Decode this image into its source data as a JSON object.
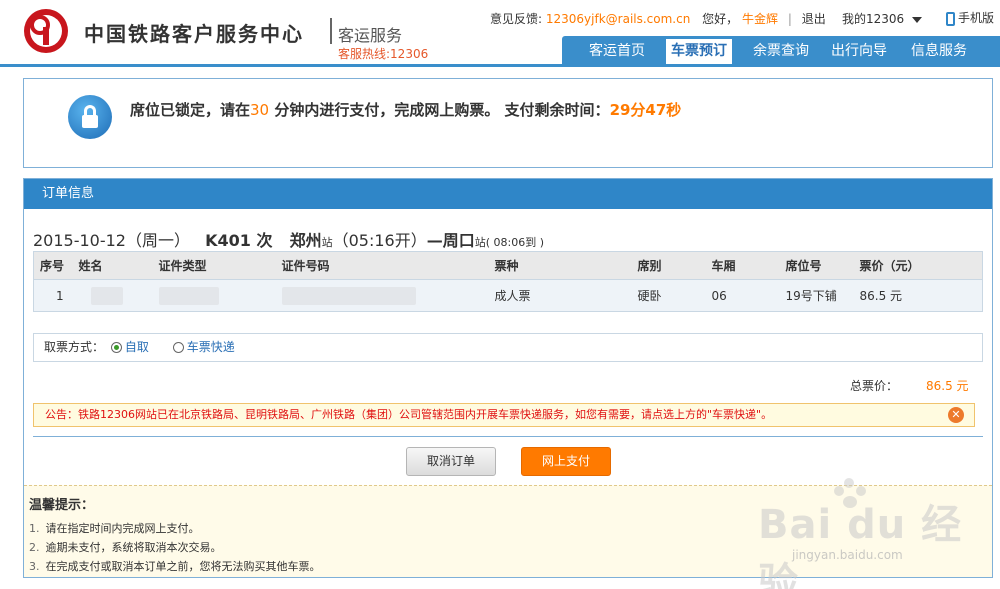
{
  "header": {
    "site_title": "中国铁路客户服务中心",
    "sub_title": "客运服务",
    "hotline": "客服热线:12306",
    "feedback_label": "意见反馈:",
    "feedback_email": "12306yjfk@rails.com.cn",
    "greeting": "您好，",
    "user_name": "牛金辉",
    "logout": "退出",
    "my12306": "我的12306",
    "mobile": "手机版"
  },
  "nav": {
    "items": [
      {
        "label": "客运首页",
        "active": false
      },
      {
        "label": "车票预订",
        "active": true
      },
      {
        "label": "余票查询",
        "active": false
      },
      {
        "label": "出行向导",
        "active": false
      },
      {
        "label": "信息服务",
        "active": false
      }
    ]
  },
  "notice": {
    "part1": "席位已锁定，请在",
    "minutes": "30",
    "part2": " 分钟内进行支付，完成网上购票。 支付剩余时间：",
    "remaining": "29分47秒"
  },
  "order": {
    "title": "订单信息",
    "train": {
      "date": "2015-10-12（周一）",
      "number": "K401 次",
      "from": "郑州",
      "from_suffix": "站",
      "depart": "（05:16开）",
      "to": "—周口",
      "to_suffix": "站",
      "arrive": "( 08:06到 )"
    },
    "columns": [
      "序号",
      "姓名",
      "证件类型",
      "证件号码",
      "票种",
      "席别",
      "车厢",
      "席位号",
      "票价（元）"
    ],
    "rows": [
      {
        "seq": "1",
        "ticket_type": "成人票",
        "seat_class": "硬卧",
        "car": "06",
        "seat_no": "19号下铺",
        "price": "86.5 元"
      }
    ],
    "pickup_label": "取票方式：",
    "pickup_self": "自取",
    "pickup_express": "车票快递",
    "total_label": "总票价：",
    "total_value": "86.5 元",
    "announcement": "公告：铁路12306网站已在北京铁路局、昆明铁路局、广州铁路（集团）公司管辖范围内开展车票快递服务，如您有需要，请点选上方的\"车票快递\"。",
    "cancel_button": "取消订单",
    "pay_button": "网上支付"
  },
  "tips": {
    "title": "温馨提示：",
    "items": [
      {
        "idx": "1.",
        "text": "请在指定时间内完成网上支付。"
      },
      {
        "idx": "2.",
        "text": "逾期未支付，系统将取消本次交易。"
      },
      {
        "idx": "3.",
        "text": "在完成支付或取消本订单之前，您将无法购买其他车票。"
      }
    ]
  },
  "watermark": {
    "brand": "Bai du 经验",
    "url": "jingyan.baidu.com"
  }
}
